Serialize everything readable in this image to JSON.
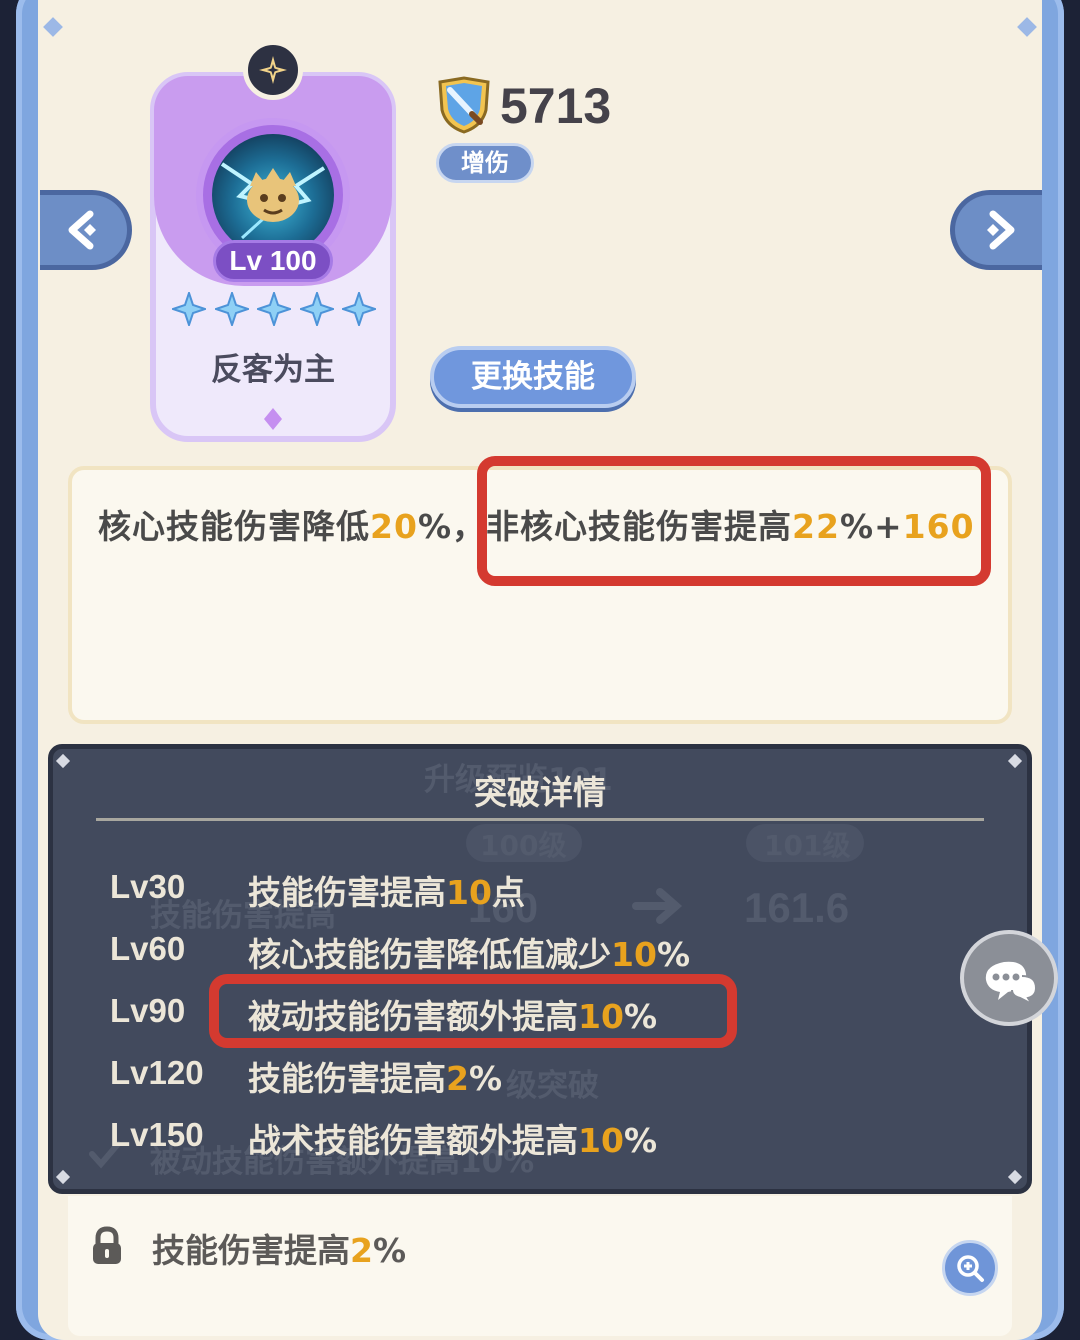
{
  "skill_card": {
    "level": "Lv 100",
    "stars": 5,
    "name": "反客为主",
    "icon": "skill-creature-lightning-icon"
  },
  "power": {
    "icon": "shield-sword-icon",
    "value": "5713",
    "tag": "增伤"
  },
  "change_button": "更换技能",
  "description": {
    "part1": "核心技能伤害降低",
    "val1": "20",
    "part2": "%，",
    "part3": "非核心技能伤害提高",
    "val2": "22",
    "part4": "%+",
    "val3": "160"
  },
  "breakthrough": {
    "title": "突破详情",
    "background_text": {
      "upgrade_label": "升级预览",
      "upgrade_num": "101",
      "current_level": "100级",
      "next_level": "101级",
      "stat_name": "技能伤害提高",
      "current_value": "160",
      "next_value": "161.6",
      "break_label": "级突破",
      "passive_text": "被动技能伤害额外提高10%"
    },
    "rows": [
      {
        "level": "Lv30",
        "text": "技能伤害提高",
        "value": "10",
        "suffix": "点"
      },
      {
        "level": "Lv60",
        "text": "核心技能伤害降低值减少",
        "value": "10",
        "suffix": "%"
      },
      {
        "level": "Lv90",
        "text": "被动技能伤害额外提高",
        "value": "10",
        "suffix": "%"
      },
      {
        "level": "Lv120",
        "text": "技能伤害提高",
        "value": "2",
        "suffix": "%"
      },
      {
        "level": "Lv150",
        "text": "战术技能伤害额外提高",
        "value": "10",
        "suffix": "%"
      }
    ]
  },
  "bottom": {
    "text": "技能伤害提高",
    "value": "2",
    "suffix": "%"
  },
  "colors": {
    "highlight": "#e8a21e",
    "annotation_red": "#d43a30",
    "frame_blue": "#7fa6df",
    "overlay_dark": "#424a5d"
  }
}
